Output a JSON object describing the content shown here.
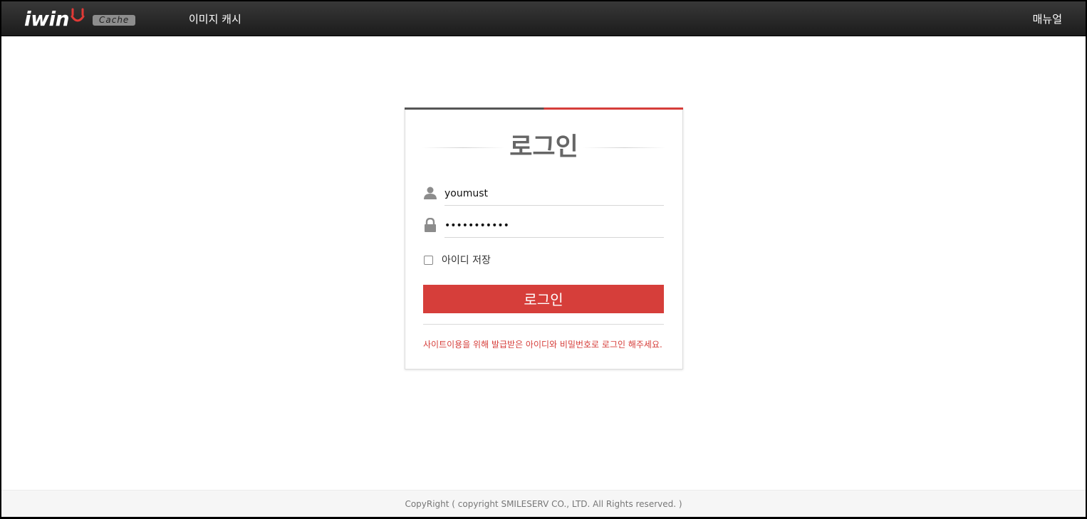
{
  "header": {
    "logo_text": "iwin",
    "logo_badge": "Cache",
    "nav_title": "이미지 캐시",
    "manual_link": "매뉴얼"
  },
  "login": {
    "title": "로그인",
    "username_value": "youmust",
    "password_value": "•••••••••••",
    "remember_label": "아이디 저장",
    "remember_checked": false,
    "submit_label": "로그인",
    "notice": "사이트이용을 위해 발급받은 아이디와 비밀번호로 로그인 해주세요."
  },
  "footer": {
    "copyright": "CopyRight ( copyright SMILESERV CO., LTD. All Rights reserved. )"
  },
  "colors": {
    "accent": "#d63e3a",
    "header_bg": "#2a2a2a",
    "title_gray": "#666666"
  },
  "icons": {
    "user": "user-icon",
    "lock": "lock-icon",
    "smile": "smile-logo-icon"
  }
}
